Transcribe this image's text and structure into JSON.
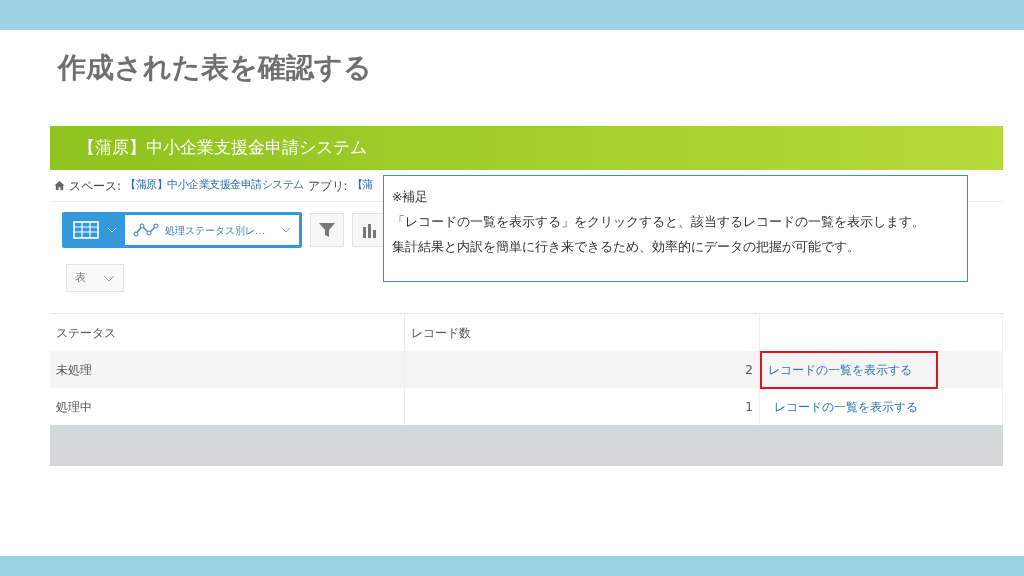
{
  "slide_title": "作成された表を確認する",
  "app": {
    "header_title": "【蒲原】中小企業支援金申請システム",
    "breadcrumb": [
      {
        "kind": "home"
      },
      {
        "kind": "label",
        "text": "スペース:"
      },
      {
        "kind": "link",
        "text": "【蒲原】中小企業支援金申請システム"
      },
      {
        "kind": "label",
        "text": "アプリ:"
      },
      {
        "kind": "link",
        "text": "【蒲"
      }
    ],
    "graph_select": "処理ステータス別レ…",
    "chart_type_select": "表",
    "table": {
      "columns": [
        "ステータス",
        "レコード数"
      ],
      "rows": [
        {
          "status": "未処理",
          "count": "2",
          "link": "レコードの一覧を表示する",
          "highlighted": true
        },
        {
          "status": "処理中",
          "count": "1",
          "link": "レコードの一覧を表示する",
          "highlighted": false
        }
      ]
    }
  },
  "note": {
    "heading": "※補足",
    "lines": [
      "「レコードの一覧を表示する」をクリックすると、該当するレコードの一覧を表示します。",
      "集計結果と内訳を簡単に行き来できるため、効率的にデータの把握が可能です。"
    ]
  }
}
